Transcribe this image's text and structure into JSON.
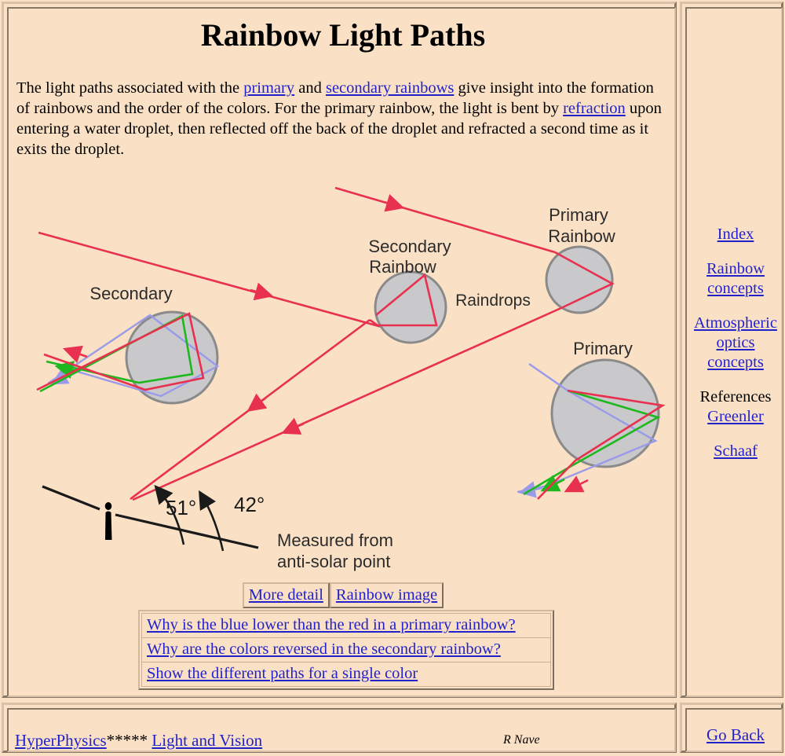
{
  "page": {
    "title": "Rainbow Light Paths",
    "background_color": "#fae1c6",
    "link_color": "#2222cc",
    "ray_color": "#e8304f"
  },
  "intro": {
    "part1": "The light paths associated with the ",
    "link_primary": "primary",
    "part2": " and ",
    "link_secondary": "secondary rainbows",
    "part3": " give insight into the formation of rainbows and the order of the colors. For the primary rainbow, the light is bent by ",
    "link_refraction": "refraction",
    "part4": " upon entering a water droplet, then reflected off the back of the droplet and refracted a second time as it exits the droplet."
  },
  "figure": {
    "labels": {
      "secondary_left": "Secondary",
      "secondary_rainbow": "Secondary\nRainbow",
      "secondary_rainbow_l1": "Secondary",
      "secondary_rainbow_l2": "Rainbow",
      "primary_rainbow_l1": "Primary",
      "primary_rainbow_l2": "Rainbow",
      "raindrops": "Raindrops",
      "primary_right": "Primary",
      "angle_51": "51°",
      "angle_42": "42°",
      "measured_l1": "Measured from",
      "measured_l2": "anti-solar point"
    },
    "colors": {
      "droplet_fill": "#c9c9cb",
      "droplet_stroke": "#8a8a8a",
      "red_ray": "#e8304f",
      "green_ray": "#1eb81e",
      "blue_ray": "#9a9aea",
      "observer": "#000000",
      "horizon": "#1a1a1a"
    }
  },
  "buttons": {
    "more_detail": "More detail",
    "rainbow_image": "Rainbow image"
  },
  "questions": [
    "Why is the blue lower than the red in a primary rainbow?",
    "Why are the colors reversed in the secondary rainbow?",
    "Show the different paths for a single color"
  ],
  "sidebar": {
    "items": [
      {
        "label": "Index",
        "link": true
      },
      {
        "label": "Rainbow\nconcepts",
        "link": true,
        "l1": "Rainbow",
        "l2": "concepts"
      },
      {
        "label": "Atmospheric optics concepts",
        "link": true,
        "l1": "Atmospheric",
        "l2": "optics",
        "l3": "concepts"
      },
      {
        "label": "References",
        "link": false
      },
      {
        "label": "Greenler",
        "link": true
      },
      {
        "label": "Schaaf",
        "link": true
      }
    ],
    "references_label": "References",
    "greenler_label": "Greenler",
    "schaaf_label": "Schaaf"
  },
  "footer": {
    "hyperphysics": "HyperPhysics",
    "stars": "*****",
    "section": "Light and Vision",
    "author": "R Nave",
    "go_back": "Go Back"
  }
}
